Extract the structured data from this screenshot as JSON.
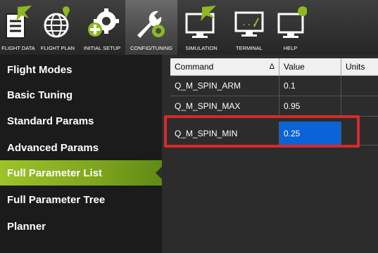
{
  "toolbar": {
    "items": [
      {
        "label": "FLIGHT DATA",
        "icon": "flight-data-icon"
      },
      {
        "label": "FLIGHT PLAN",
        "icon": "globe-plan-icon"
      },
      {
        "label": "INITIAL SETUP",
        "icon": "gear-plus-icon"
      },
      {
        "label": "CONFIG/TUNING",
        "icon": "wrench-gear-icon"
      },
      {
        "label": "SIMULATION",
        "icon": "monitor-plane-icon"
      },
      {
        "label": "TERMINAL",
        "icon": "terminal-icon"
      },
      {
        "label": "HELP",
        "icon": "help-icon"
      }
    ]
  },
  "sidebar": {
    "items": [
      {
        "label": "Flight Modes"
      },
      {
        "label": "Basic Tuning"
      },
      {
        "label": "Standard Params"
      },
      {
        "label": "Advanced Params"
      },
      {
        "label": "Full Parameter List",
        "active": true
      },
      {
        "label": "Full Parameter Tree"
      },
      {
        "label": "Planner"
      }
    ]
  },
  "grid": {
    "columns": [
      "Command",
      "Value",
      "Units"
    ],
    "sort_indicator": "Δ",
    "rows": [
      {
        "command": "Q_M_SPIN_ARM",
        "value": "0.1",
        "units": ""
      },
      {
        "command": "Q_M_SPIN_MAX",
        "value": "0.95",
        "units": ""
      },
      {
        "command": "Q_M_SPIN_MIN",
        "value": "0.25",
        "units": "",
        "selected": true
      }
    ]
  },
  "colors": {
    "accent_green": "#8db824",
    "selection_blue": "#0a64d8",
    "highlight_red": "#d62a2a"
  }
}
